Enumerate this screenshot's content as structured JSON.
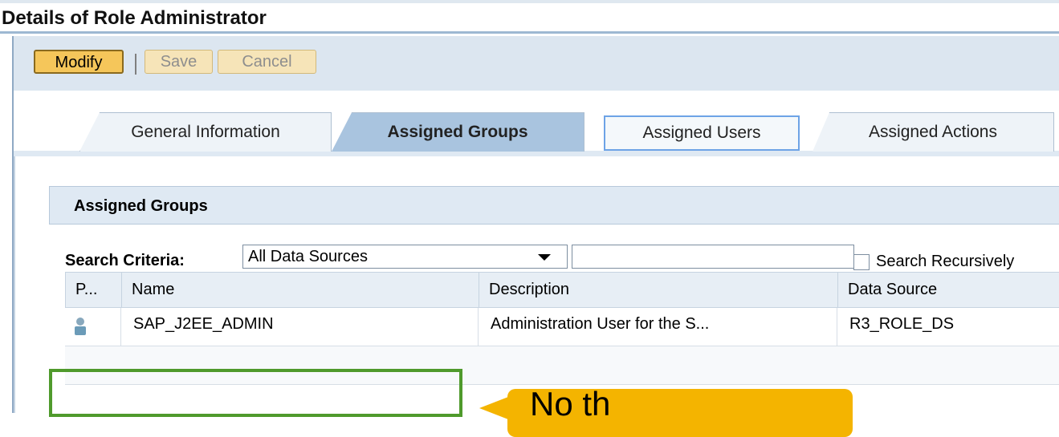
{
  "window": {
    "title": "Details of Role Administrator"
  },
  "toolbar": {
    "modify_label": "Modify",
    "save_label": "Save",
    "cancel_label": "Cancel"
  },
  "tabs": [
    {
      "label": "General Information"
    },
    {
      "label": "Assigned Groups",
      "active": true
    },
    {
      "label": "Assigned Users"
    },
    {
      "label": "Assigned Actions"
    }
  ],
  "panel": {
    "title": "Assigned Groups"
  },
  "search": {
    "label": "Search Criteria:",
    "data_source": "All Data Sources",
    "text_value": "",
    "recursive_label": "Search Recursively"
  },
  "table": {
    "columns": [
      "P...",
      "Name",
      "Description",
      "Data Source"
    ],
    "rows": [
      {
        "name": "SAP_J2EE_ADMIN",
        "description": "Administration User for the S...",
        "data_source": "R3_ROLE_DS"
      }
    ]
  },
  "callout": {
    "text": "No th"
  },
  "colors": {
    "accent": "#f5c65a",
    "selected_tab": "#a9c4df",
    "highlight": "#4f9a2c",
    "callout": "#f4b400"
  }
}
